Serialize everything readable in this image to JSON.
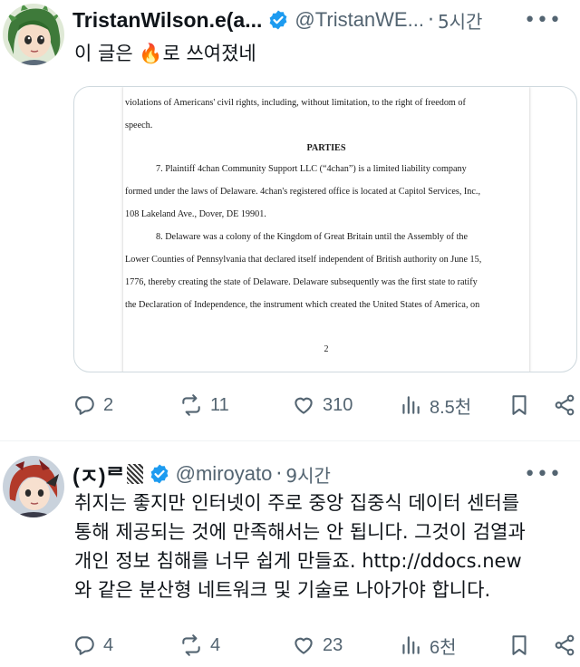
{
  "tweets": [
    {
      "author": "TristanWilson.e(a...",
      "handle": "@TristanWE...",
      "time": "5시간",
      "text_lines": [
        "이 글은 🔥로 쓰여졌네"
      ],
      "document": {
        "lines": [
          "violations of Americans' civil rights, including, without limitation, to the right of freedom of",
          "speech.",
          "PARTIES",
          "7.        Plaintiff 4chan Community Support LLC (“4chan”) is a limited liability company",
          "formed under the laws of Delaware. 4chan's registered office is located at Capitol Services, Inc.,",
          "108 Lakeland Ave., Dover, DE 19901.",
          "8.        Delaware was a colony of the Kingdom of Great Britain until the Assembly of the",
          "Lower Counties of Pennsylvania that declared itself independent of British authority on June 15,",
          "1776, thereby creating the state of Delaware. Delaware subsequently was the first state to ratify",
          "the Declaration of Independence, the instrument which created the United States of America, on"
        ],
        "page_number": "2"
      },
      "stats": {
        "replies": "2",
        "reposts": "11",
        "likes": "310",
        "views": "8.5천"
      }
    },
    {
      "author": "(ㅈ)ᄅ",
      "handle": "@miroyato",
      "time": "9시간",
      "text_lines": [
        "취지는 좋지만 인터넷이 주로 중앙 집중식 데이터 센터를",
        "통해 제공되는 것에 만족해서는 안 됩니다. 그것이 검열과",
        "개인 정보 침해를 너무 쉽게 만들죠. http://ddocs.new",
        "와 같은 분산형 네트워크 및 기술로 나아가야 합니다."
      ],
      "stats": {
        "replies": "4",
        "reposts": "4",
        "likes": "23",
        "views": "6천"
      }
    }
  ],
  "icons": {
    "verified": "verified-badge-icon",
    "reply": "reply-icon",
    "repost": "repost-icon",
    "like": "heart-icon",
    "views": "views-bar-icon",
    "bookmark": "bookmark-icon",
    "share": "share-icon",
    "more": "more-dots-icon"
  },
  "colors": {
    "verified": "#1d9bf0",
    "secondary": "#536471",
    "text": "#0f1419"
  }
}
